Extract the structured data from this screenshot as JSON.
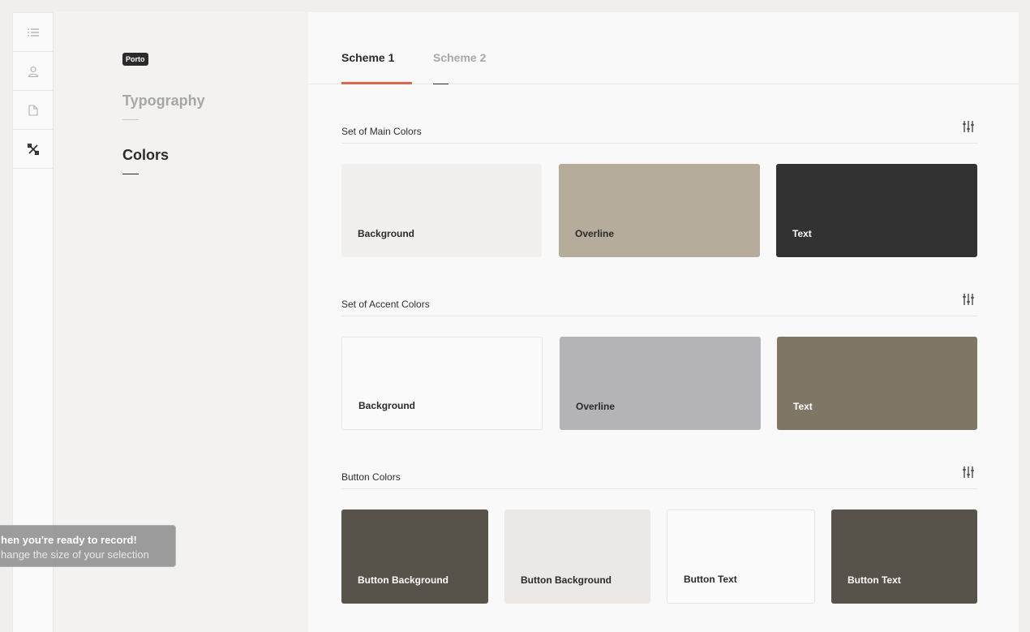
{
  "sidebar": {
    "icons": [
      "list-icon",
      "user-icon",
      "document-icon",
      "tools-icon"
    ]
  },
  "panel": {
    "badge": "Porto",
    "nav": [
      {
        "label": "Typography",
        "active": false
      },
      {
        "label": "Colors",
        "active": true
      }
    ]
  },
  "tabs": [
    {
      "label": "Scheme 1",
      "active": true
    },
    {
      "label": "Scheme 2",
      "active": false
    }
  ],
  "sections": [
    {
      "title": "Set of Main Colors",
      "swatches": [
        {
          "label": "Background",
          "color": "#f1f0ef"
        },
        {
          "label": "Overline",
          "color": "#b5ac9b"
        },
        {
          "label": "Text",
          "color": "#323232"
        }
      ]
    },
    {
      "title": "Set of Accent Colors",
      "swatches": [
        {
          "label": "Background",
          "color": "#fbfbfb"
        },
        {
          "label": "Overline",
          "color": "#b4b3b6"
        },
        {
          "label": "Text",
          "color": "#7f7766"
        }
      ]
    },
    {
      "title": "Button Colors",
      "swatches": [
        {
          "label": "Button Background",
          "color": "#57534a"
        },
        {
          "label": "Button Background",
          "color": "#ebe8e6"
        },
        {
          "label": "Button Text",
          "color": "#fbfbfb"
        },
        {
          "label": "Button Text",
          "color": "#57534a"
        }
      ]
    }
  ],
  "toast": {
    "title": "hen you're ready to record!",
    "subtitle": "hange the size of your selection"
  }
}
